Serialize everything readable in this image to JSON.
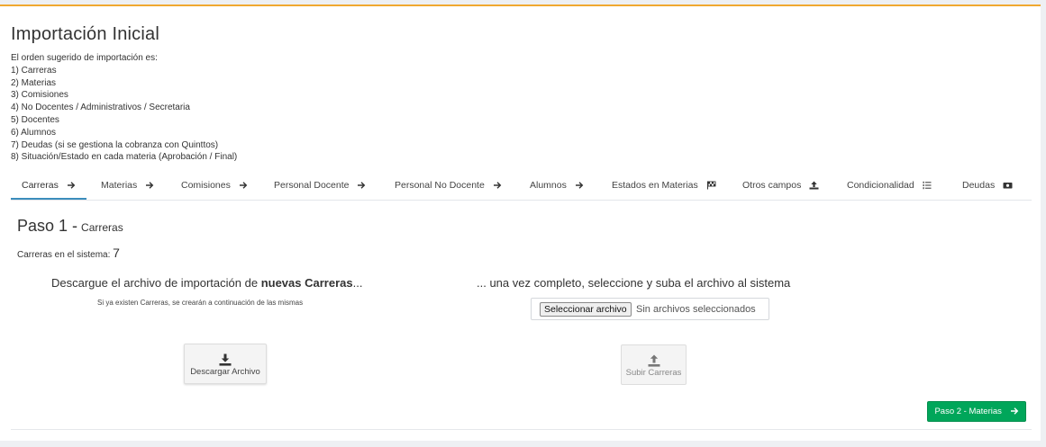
{
  "page": {
    "title": "Importación Inicial"
  },
  "intro": {
    "heading": "El orden sugerido de importación es:",
    "items": [
      "1) Carreras",
      "2) Materias",
      "3) Comisiones",
      "4) No Docentes / Administrativos / Secretaria",
      "5) Docentes",
      "6) Alumnos",
      "7) Deudas (si se gestiona la cobranza con Quinttos)",
      "8) Situación/Estado en cada materia (Aprobación / Final)"
    ]
  },
  "tabs": [
    {
      "label": "Carreras",
      "icon": "arrow-right-icon",
      "active": true
    },
    {
      "label": "Materias",
      "icon": "arrow-right-icon",
      "active": false
    },
    {
      "label": "Comisiones",
      "icon": "arrow-right-icon",
      "active": false
    },
    {
      "label": "Personal Docente",
      "icon": "arrow-right-icon",
      "active": false
    },
    {
      "label": "Personal No Docente",
      "icon": "arrow-right-icon",
      "active": false
    },
    {
      "label": "Alumnos",
      "icon": "arrow-right-icon",
      "active": false
    },
    {
      "label": "Estados en Materias",
      "icon": "flag-checkered-icon",
      "active": false
    },
    {
      "label": "Otros campos",
      "icon": "upload-icon",
      "active": false
    },
    {
      "label": "Condicionalidad",
      "icon": "list-ordered-icon",
      "active": false
    },
    {
      "label": "Deudas",
      "icon": "money-bill-icon",
      "active": false
    }
  ],
  "step": {
    "title": "Paso 1 -",
    "subtitle": "Carreras",
    "count_label": "Carreras en el sistema:",
    "count_value": "7"
  },
  "download": {
    "heading_prefix": "Descargue el archivo de importación de ",
    "heading_bold": "nuevas Carreras",
    "heading_suffix": "...",
    "note": "Si ya existen Carreras, se crearán a continuación de las mismas",
    "button_label": "Descargar Archivo"
  },
  "upload": {
    "heading": "... una vez completo, seleccione y suba el archivo al sistema",
    "file_button": "Seleccionar archivo",
    "file_status": "Sin archivos seleccionados",
    "button_label": "Subir Carreras"
  },
  "next": {
    "label": "Paso 2 - Materias"
  },
  "colors": {
    "accent_top": "#f0a830",
    "tab_active": "#3c8dbc",
    "success": "#00a65a"
  }
}
